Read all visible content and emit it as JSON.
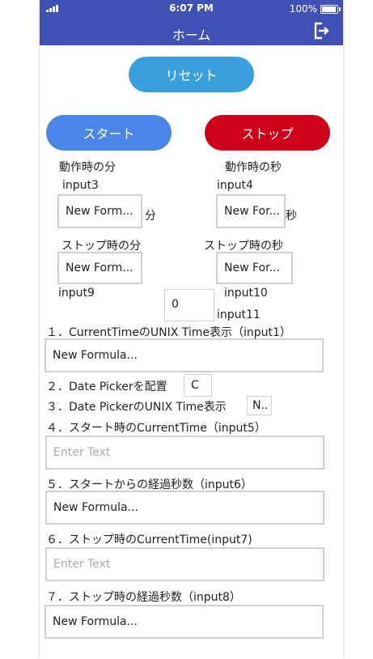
{
  "status_bar": {
    "time": "6:07 PM",
    "battery": "100%"
  },
  "header": {
    "title": "ホーム",
    "exit_icon": "exit-icon"
  },
  "buttons": {
    "reset": "リセット",
    "start": "スタート",
    "stop": "ストップ"
  },
  "colors": {
    "header": "#3f51b5",
    "reset": "#3aa0dd",
    "start": "#4a86e8",
    "stop": "#d0021b"
  },
  "labels": {
    "run_minutes": "動作時の分",
    "run_seconds": "動作時の秒",
    "input3": "input3",
    "input4": "input4",
    "unit_min": "分",
    "unit_sec": "秒",
    "stop_minutes": "ストップ時の分",
    "stop_seconds": "ストップ時の秒",
    "input9": "input9",
    "input10": "input10",
    "input11": "input11",
    "line1": "１．CurrentTimeのUNIX Time表示（input1）",
    "line2": "２．Date Pickerを配置",
    "line3": "３．Date PickerのUNIX Time表示",
    "line4": "４．スタート時のCurrentTime（input5）",
    "line5": "５．スタートからの経過秒数（input6）",
    "line6": "６．ストップ時のCurrentTime(input7)",
    "line7": "７．ストップ時の経過秒数（input8）"
  },
  "fields": {
    "input3": "New Form...",
    "input4": "New For...",
    "input9": "New Form...",
    "input10": "New For...",
    "input11": "0",
    "input1": "New Formula...",
    "date_picker": "C",
    "date_unix": "N..",
    "input5_placeholder": "Enter Text",
    "input6": "New Formula...",
    "input7_placeholder": "Enter Text",
    "input8": "New Formula..."
  }
}
